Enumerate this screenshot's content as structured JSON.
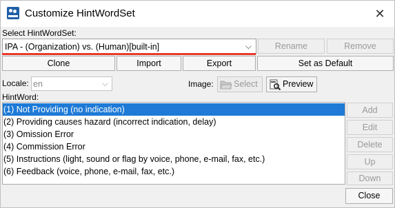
{
  "window": {
    "title": "Customize HintWordSet",
    "close_glyph": "✕"
  },
  "select_label": "Select HintWordSet:",
  "hintwordset_combo": {
    "value": "IPA - (Organization) vs. (Human)[built-in]",
    "chevron": "⌵"
  },
  "buttons": {
    "rename": "Rename",
    "remove": "Remove",
    "clone": "Clone",
    "import": "Import",
    "export": "Export",
    "set_default": "Set as Default",
    "select": "Select",
    "preview": "Preview",
    "add": "Add",
    "edit": "Edit",
    "delete": "Delete",
    "up": "Up",
    "down": "Down",
    "close": "Close"
  },
  "locale": {
    "label": "Locale:",
    "value": "en",
    "chevron": "⌵"
  },
  "image_label": "Image:",
  "hintword_label": "HintWord:",
  "hintwords": [
    "(1) Not Providing (no indication)",
    "(2) Providing causes hazard (incorrect indication, delay)",
    "(3) Omission Error",
    "(4) Commission Error",
    "(5) Instructions (light, sound or flag by voice, phone, e-mail, fax, etc.)",
    "(6) Feedback (voice, phone, e-mail, fax, etc.)"
  ],
  "selected_index": 0,
  "colors": {
    "selection": "#1e7ad6",
    "highlight_underline": "#e8392c",
    "app_icon": "#1f5fa8"
  }
}
